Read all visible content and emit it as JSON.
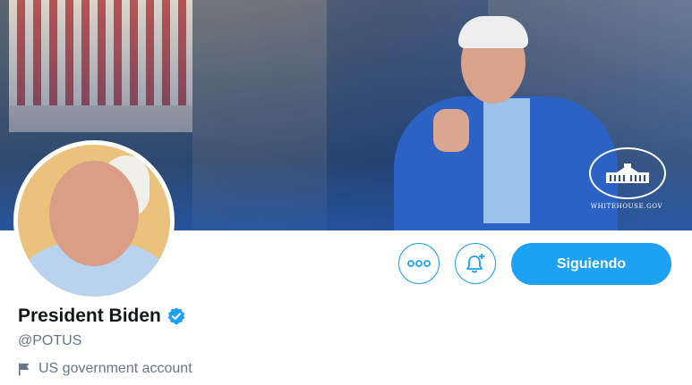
{
  "banner": {
    "logo_caption": "WHITEHOUSE.GOV"
  },
  "profile": {
    "name": "President Biden",
    "handle": "@POTUS",
    "label_text": "US government account",
    "verified": true
  },
  "actions": {
    "more_icon": "more-icon",
    "notifications_icon": "bell-add-icon",
    "follow_label": "Siguiendo"
  },
  "colors": {
    "accent": "#1da1f2",
    "name": "#14171a",
    "secondary_text": "#657786"
  }
}
